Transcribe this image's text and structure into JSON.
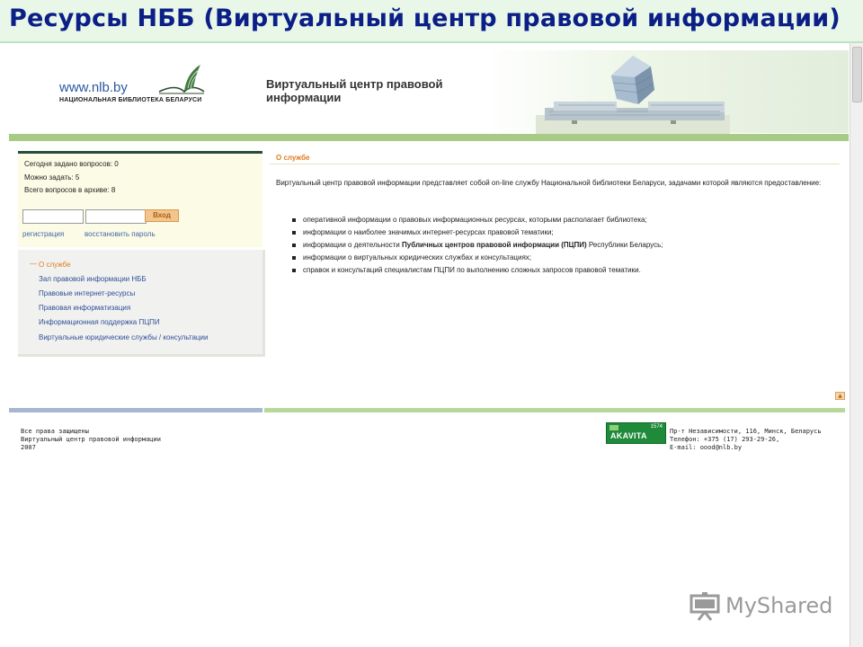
{
  "slide": {
    "title": "Ресурсы НББ (Виртуальный центр правовой информации)"
  },
  "site": {
    "logo_url": "www.nlb.by",
    "logo_sub": "НАЦИОНАЛЬНАЯ БИБЛИОТЕКА БЕЛАРУСИ",
    "title_line1": "Виртуальный центр правовой",
    "title_line2": "информации"
  },
  "login": {
    "stats": [
      "Сегодня задано вопросов: 0",
      "Можно задать: 5",
      "Всего вопросов в архиве: 8"
    ],
    "login_value": "",
    "password_value": "",
    "button_label": "Вход",
    "register_link": "регистрация",
    "restore_link": "восстановить пароль"
  },
  "nav": {
    "marker": "—",
    "items": [
      "О службе",
      "Зал правовой информации НББ",
      "Правовые интернет-ресурсы",
      "Правовая информатизация",
      "Информационная поддержка ПЦПИ",
      "Виртуальные юридические службы / консультации"
    ]
  },
  "content": {
    "title": "О службе",
    "intro": "Виртуальный центр правовой информации представляет собой on-line службу Национальной библиотеки Беларуси, задачами которой являются предоставление:",
    "bullets": [
      "оперативной информации о правовых информационных ресурсах, которыми располагает библиотека;",
      "информации о наиболее значимых интернет-ресурсах правовой тематики;",
      "информации о деятельности ",
      "информации о виртуальных юридических службах и консультациях;",
      "справок и консультаций специалистам ПЦПИ по выполнению сложных запросов правовой тематики."
    ],
    "bullet3_bold": "Публичных центров правовой информации (ПЦПИ)",
    "bullet3_tail": " Республики Беларусь;"
  },
  "footer": {
    "left_lines": [
      "Все права защищены",
      "Виртуальный центр правовой информации",
      "2007"
    ],
    "counter_name": "AKAVITA",
    "counter_number": "1574",
    "right_lines": [
      "Пр-т Независимости, 116, Минск, Беларусь",
      "Телефон: +375 (17) 293-29-26,",
      "E-mail: oood@nlb.by"
    ]
  },
  "watermark": {
    "text": "MyShared"
  },
  "colors": {
    "slide_title": "#0b1f86",
    "accent_orange": "#e07a1f",
    "link_blue": "#2f4f9a",
    "green_bar": "#a7cb84"
  },
  "icons": {
    "logo": "book-wing-icon",
    "up": "arrow-up-icon",
    "watermark": "presentation-screen-icon"
  }
}
